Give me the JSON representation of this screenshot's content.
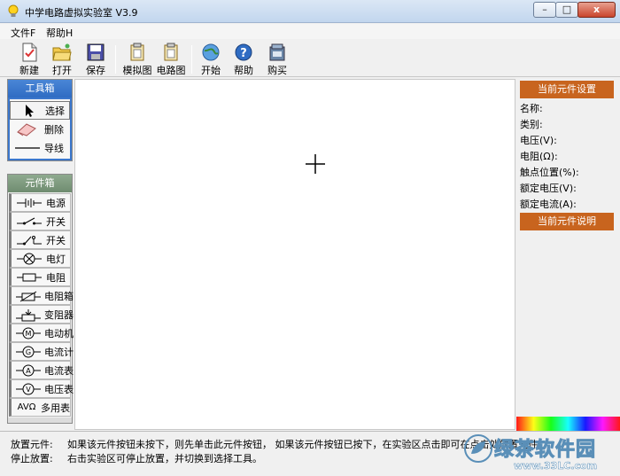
{
  "window": {
    "title": "中学电路虚拟实验室 V3.9",
    "close_glyph": "x",
    "minimize_glyph": "–",
    "maximize_glyph": "□"
  },
  "menu": {
    "items": [
      {
        "label": "文件F"
      },
      {
        "label": "帮助H"
      }
    ]
  },
  "toolbar": {
    "buttons": [
      {
        "label": "新建",
        "icon": "new-document-icon"
      },
      {
        "label": "打开",
        "icon": "open-folder-icon"
      },
      {
        "label": "保存",
        "icon": "save-disk-icon"
      },
      {
        "label": "模拟图",
        "icon": "simulation-diagram-icon"
      },
      {
        "label": "电路图",
        "icon": "circuit-diagram-icon"
      },
      {
        "label": "开始",
        "icon": "start-globe-icon"
      },
      {
        "label": "帮助",
        "icon": "help-icon"
      },
      {
        "label": "购买",
        "icon": "purchase-icon"
      }
    ]
  },
  "toolbox": {
    "title": "工具箱",
    "items": [
      {
        "label": "选择",
        "icon": "arrow-pointer-icon",
        "selected": true
      },
      {
        "label": "删除",
        "icon": "eraser-icon"
      },
      {
        "label": "导线",
        "icon": "wire-line-icon"
      }
    ]
  },
  "components": {
    "title": "元件箱",
    "items": [
      {
        "label": "电源",
        "icon": "battery-symbol-icon"
      },
      {
        "label": "开关",
        "icon": "switch-symbol-icon"
      },
      {
        "label": "开关",
        "icon": "switch-alt-symbol-icon"
      },
      {
        "label": "电灯",
        "icon": "lamp-symbol-icon"
      },
      {
        "label": "电阻",
        "icon": "resistor-symbol-icon"
      },
      {
        "label": "电阻箱",
        "icon": "resistor-box-symbol-icon"
      },
      {
        "label": "变阻器",
        "icon": "rheostat-symbol-icon"
      },
      {
        "label": "电动机",
        "icon": "motor-symbol-icon"
      },
      {
        "label": "电流计",
        "icon": "galvanometer-symbol-icon"
      },
      {
        "label": "电流表",
        "icon": "ammeter-symbol-icon"
      },
      {
        "label": "电压表",
        "icon": "voltmeter-symbol-icon"
      },
      {
        "label": "多用表",
        "icon": "multimeter-icon",
        "prefix": "AVΩ"
      }
    ]
  },
  "current_component": {
    "settings_title": "当前元件设置",
    "fields": [
      {
        "label": "名称:"
      },
      {
        "label": "类别:"
      },
      {
        "label": "电压(V):"
      },
      {
        "label": "电阻(Ω):"
      },
      {
        "label": "触点位置(%):"
      },
      {
        "label": "额定电压(V):"
      },
      {
        "label": "额定电流(A):"
      }
    ],
    "description_title": "当前元件说明"
  },
  "status": {
    "rows": [
      {
        "key": "放置元件:",
        "text": "如果该元件按钮未按下，则先单击此元件按钮， 如果该元件按钮已按下，在实验区点击即可在点击处放置元件。"
      },
      {
        "key": "停止放置:",
        "text": "右击实验区可停止放置，并切换到选择工具。"
      }
    ]
  },
  "watermark": {
    "text": "绿茶软件园",
    "url": "www.33LC.com"
  },
  "colors": {
    "toolbox_header": "#2f6cc3",
    "component_header": "#6f8c70",
    "right_header": "#c8641e"
  }
}
